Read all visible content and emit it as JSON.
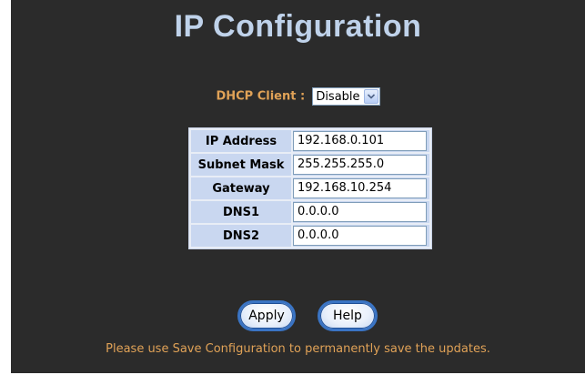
{
  "header": {
    "title": "IP Configuration"
  },
  "dhcp": {
    "label": "DHCP Client :",
    "selected": "Disable"
  },
  "ip_table": {
    "rows": [
      {
        "label": "IP Address",
        "value": "192.168.0.101"
      },
      {
        "label": "Subnet Mask",
        "value": "255.255.255.0"
      },
      {
        "label": "Gateway",
        "value": "192.168.10.254"
      },
      {
        "label": "DNS1",
        "value": "0.0.0.0"
      },
      {
        "label": "DNS2",
        "value": "0.0.0.0"
      }
    ]
  },
  "buttons": {
    "apply": "Apply",
    "help": "Help"
  },
  "footer": {
    "note": "Please use Save Configuration to permanently save the updates."
  },
  "icons": {
    "select_arrow": "chevron-down-icon"
  },
  "colors": {
    "panel_bg": "#2b2b2b",
    "title": "#bfd2ea",
    "accent_text": "#e0a257",
    "table_cell": "#c9d7f0",
    "button_border": "#3a74c4"
  }
}
